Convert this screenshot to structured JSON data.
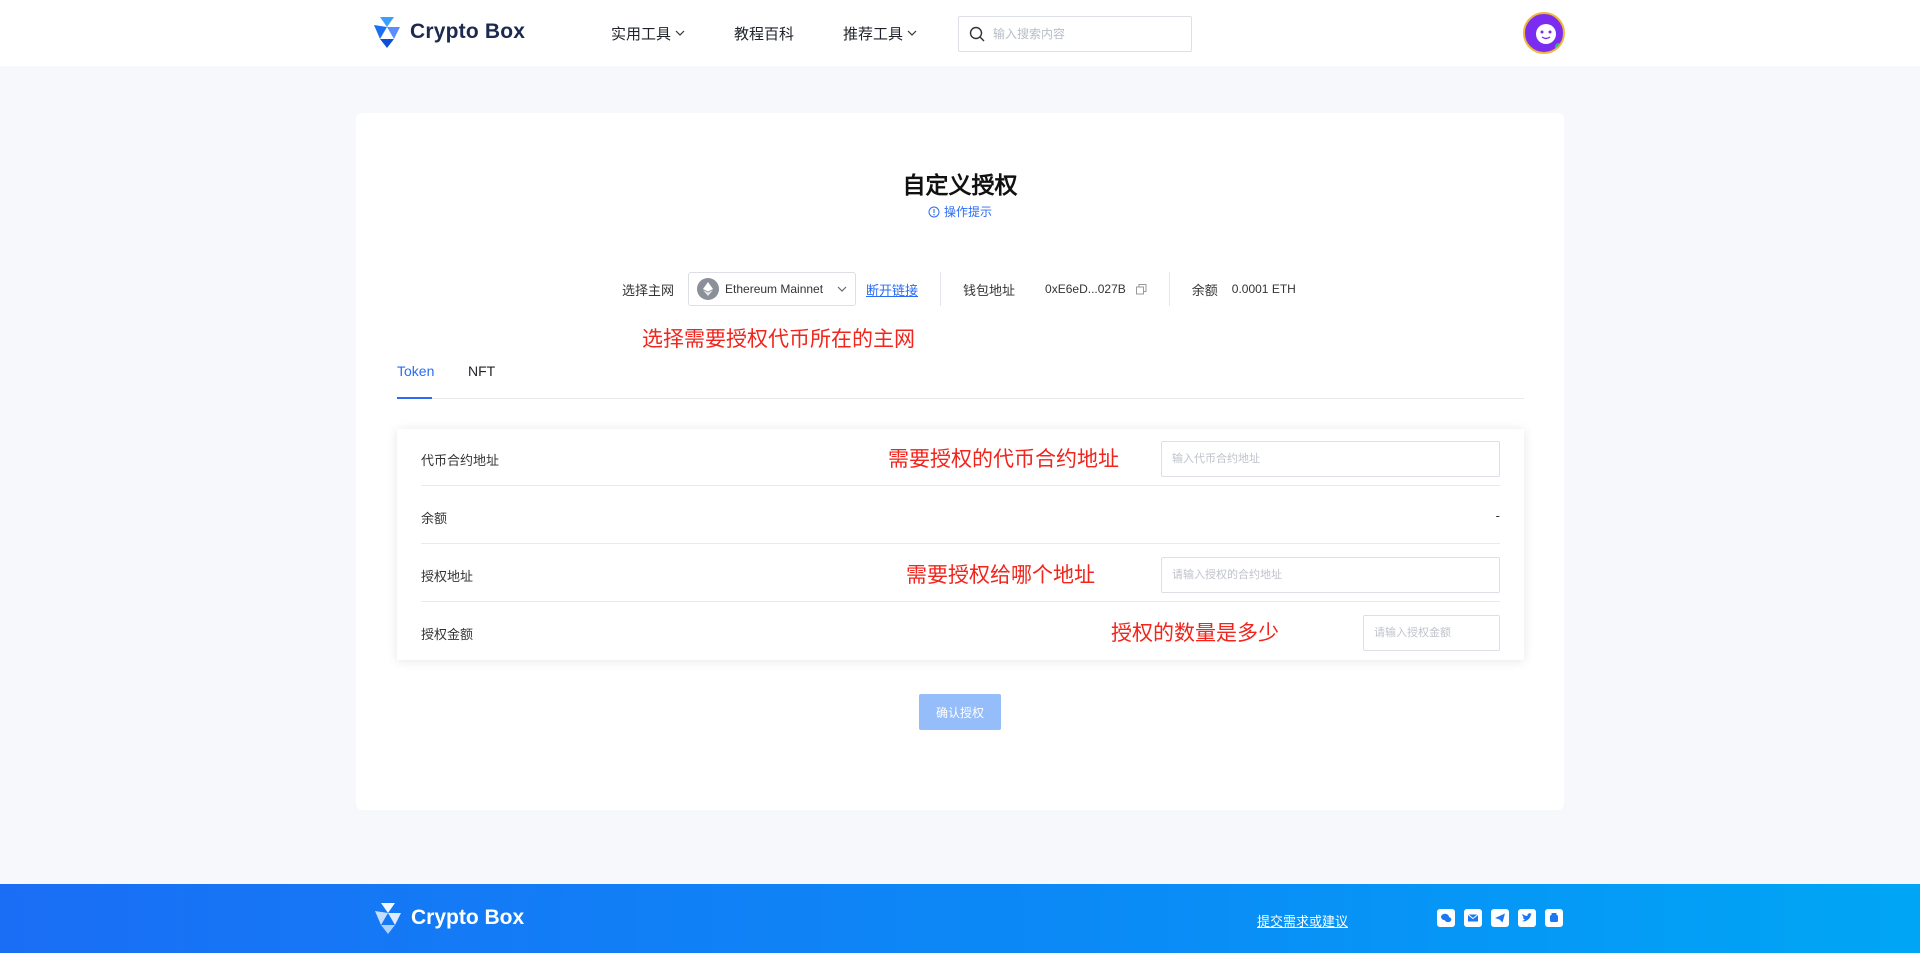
{
  "header": {
    "brand": "Crypto Box",
    "nav": [
      {
        "label": "实用工具",
        "dropdown": true
      },
      {
        "label": "教程百科",
        "dropdown": false
      },
      {
        "label": "推荐工具",
        "dropdown": true
      }
    ],
    "search_placeholder": "输入搜索内容",
    "avatar_icon": "avatar-icon"
  },
  "page": {
    "title": "自定义授权",
    "hint": "操作提示",
    "network_label": "选择主网",
    "network_value": "Ethereum Mainnet",
    "disconnect": "断开链接",
    "wallet_label": "钱包地址",
    "wallet_address": "0xE6eD...027B",
    "balance_label": "余额",
    "balance_value": "0.0001 ETH"
  },
  "annotations": {
    "network": "选择需要授权代币所在的主网",
    "token_address": "需要授权的代币合约地址",
    "spender": "需要授权给哪个地址",
    "amount": "授权的数量是多少"
  },
  "tabs": [
    {
      "label": "Token",
      "active": true
    },
    {
      "label": "NFT",
      "active": false
    }
  ],
  "form": {
    "token_address_label": "代币合约地址",
    "token_address_placeholder": "输入代币合约地址",
    "balance_label": "余额",
    "balance_value": "-",
    "spender_label": "授权地址",
    "spender_placeholder": "请输入授权的合约地址",
    "amount_label": "授权金额",
    "amount_placeholder": "请输入授权金额"
  },
  "confirm_button": "确认授权",
  "footer": {
    "brand": "Crypto Box",
    "feedback": "提交需求或建议",
    "socials": [
      "wechat-icon",
      "email-icon",
      "telegram-icon",
      "twitter-icon",
      "cup-icon"
    ]
  },
  "colors": {
    "accent": "#2a6cf6",
    "annotation": "#f2241b",
    "confirm_disabled": "#95bdf9",
    "footer_start": "#1a6ef5",
    "footer_end": "#00a6f5"
  }
}
